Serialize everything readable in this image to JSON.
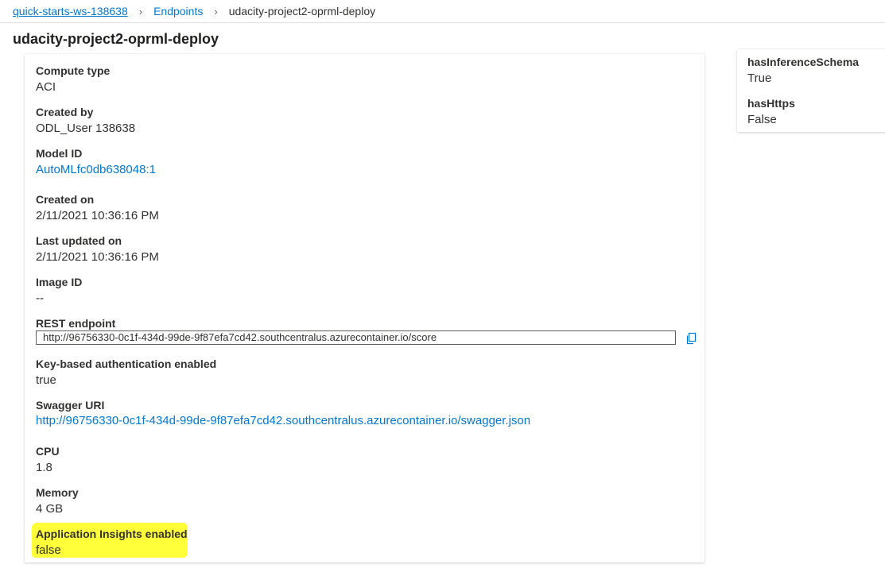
{
  "breadcrumb": {
    "workspace": "quick-starts-ws-138638",
    "endpoints": "Endpoints",
    "current": "udacity-project2-oprml-deploy",
    "separator": "›"
  },
  "page_title": "udacity-project2-oprml-deploy",
  "details": {
    "compute_type": {
      "label": "Compute type",
      "value": "ACI"
    },
    "created_by": {
      "label": "Created by",
      "value": "ODL_User 138638"
    },
    "model_id": {
      "label": "Model ID",
      "value": "AutoMLfc0db638048:1"
    },
    "created_on": {
      "label": "Created on",
      "value": "2/11/2021 10:36:16 PM"
    },
    "last_updated_on": {
      "label": "Last updated on",
      "value": "2/11/2021 10:36:16 PM"
    },
    "image_id": {
      "label": "Image ID",
      "value": "--"
    },
    "rest_endpoint": {
      "label": "REST endpoint",
      "value": "http://96756330-0c1f-434d-99de-9f87efa7cd42.southcentralus.azurecontainer.io/score"
    },
    "key_auth": {
      "label": "Key-based authentication enabled",
      "value": "true"
    },
    "swagger_uri": {
      "label": "Swagger URI",
      "value": "http://96756330-0c1f-434d-99de-9f87efa7cd42.southcentralus.azurecontainer.io/swagger.json"
    },
    "cpu": {
      "label": "CPU",
      "value": "1.8"
    },
    "memory": {
      "label": "Memory",
      "value": "4 GB"
    },
    "app_insights": {
      "label": "Application Insights enabled",
      "value": "false"
    }
  },
  "side": {
    "has_inference_schema": {
      "label": "hasInferenceSchema",
      "value": "True"
    },
    "has_https": {
      "label": "hasHttps",
      "value": "False"
    }
  },
  "colors": {
    "link": "#0078d4",
    "highlight": "#ffff3a"
  },
  "icons": {
    "copy": "copy-icon",
    "chevron": "chevron-right-icon"
  }
}
